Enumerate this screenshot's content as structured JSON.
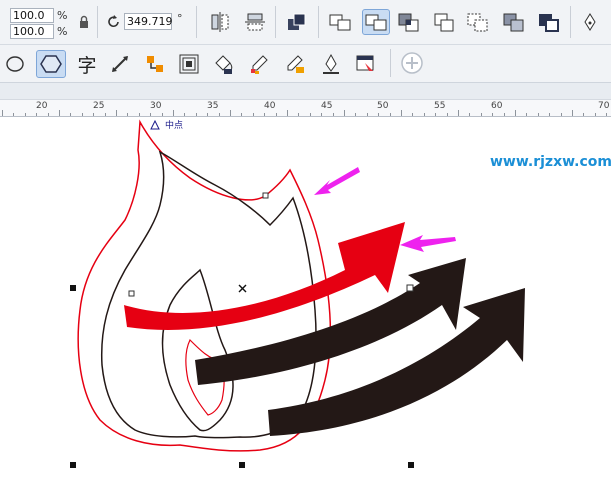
{
  "toolbar": {
    "width_value": "100.0",
    "height_value": "100.0",
    "width_unit": "%",
    "height_unit": "%",
    "rotation_value": "349.719",
    "rotation_unit": "°"
  },
  "icons": {
    "lock": "lock-icon",
    "rotate": "rotate-icon",
    "text_tool": "字"
  },
  "ruler": {
    "labels": [
      "20",
      "25",
      "30",
      "35",
      "40",
      "45",
      "50",
      "55",
      "60",
      "70"
    ]
  },
  "canvas": {
    "midpoint_label": "中点",
    "watermark": "www.rjzxw.com"
  },
  "colors": {
    "accent": "#e8323c",
    "pointer": "#ee22ee",
    "arrow_red": "#e60012",
    "arrow_black": "#231816",
    "watermark": "#1b8fd6"
  }
}
